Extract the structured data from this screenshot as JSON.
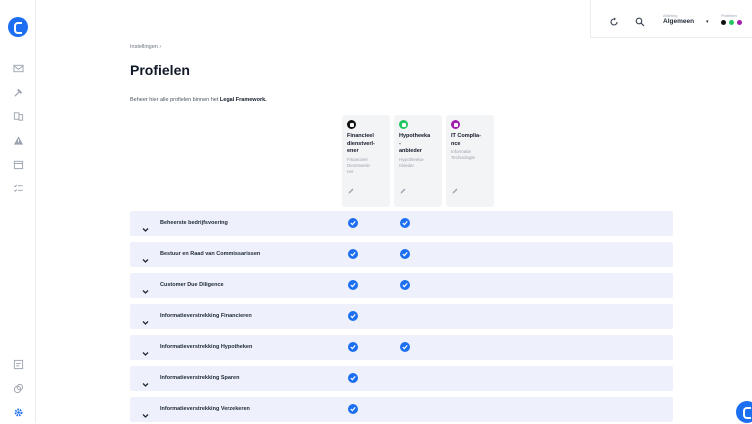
{
  "breadcrumb": "Instellingen  ›",
  "title": "Profielen",
  "description_prefix": "Beheer hier alle profielen binnen het ",
  "description_bold": "Legal Framework.",
  "topbar": {
    "afdeling_label": "Afdeling",
    "afdeling_value": "Algemeen",
    "profielen_label": "Profielen",
    "dot_colors": [
      "#111111",
      "#22c55e",
      "#a21caf"
    ]
  },
  "colors": {
    "accent": "#1d6ff2",
    "row_bg": "#eef1fb",
    "card_bg": "#f3f4f6"
  },
  "profiles": [
    {
      "name": "Financieel\ndienstverl-\nener",
      "sub": "Financieel\nDienstverle-\nner",
      "icon_color": "#111111"
    },
    {
      "name": "Hypotheeka\n-\nanbieder",
      "sub": "Hypotheeka-\nnbieder",
      "icon_color": "#22c55e"
    },
    {
      "name": "IT Complia-\nnce",
      "sub": "Informatie\nTechnologie",
      "icon_color": "#a21caf"
    }
  ],
  "rows": [
    {
      "label": "Beheerste bedrijfsvoering",
      "checks": [
        true,
        true,
        false
      ]
    },
    {
      "label": "Bestuur en Raad van Commissarissen",
      "checks": [
        true,
        true,
        false
      ]
    },
    {
      "label": "Customer Due Diligence",
      "checks": [
        true,
        true,
        false
      ]
    },
    {
      "label": "Informatieverstrekking Financieren",
      "checks": [
        true,
        false,
        false
      ]
    },
    {
      "label": "Informatieverstrekking Hypotheken",
      "checks": [
        true,
        true,
        false
      ]
    },
    {
      "label": "Informatieverstrekking Sparen",
      "checks": [
        true,
        false,
        false
      ]
    },
    {
      "label": "Informatieverstrekking Verzekeren",
      "checks": [
        true,
        false,
        false
      ]
    }
  ]
}
